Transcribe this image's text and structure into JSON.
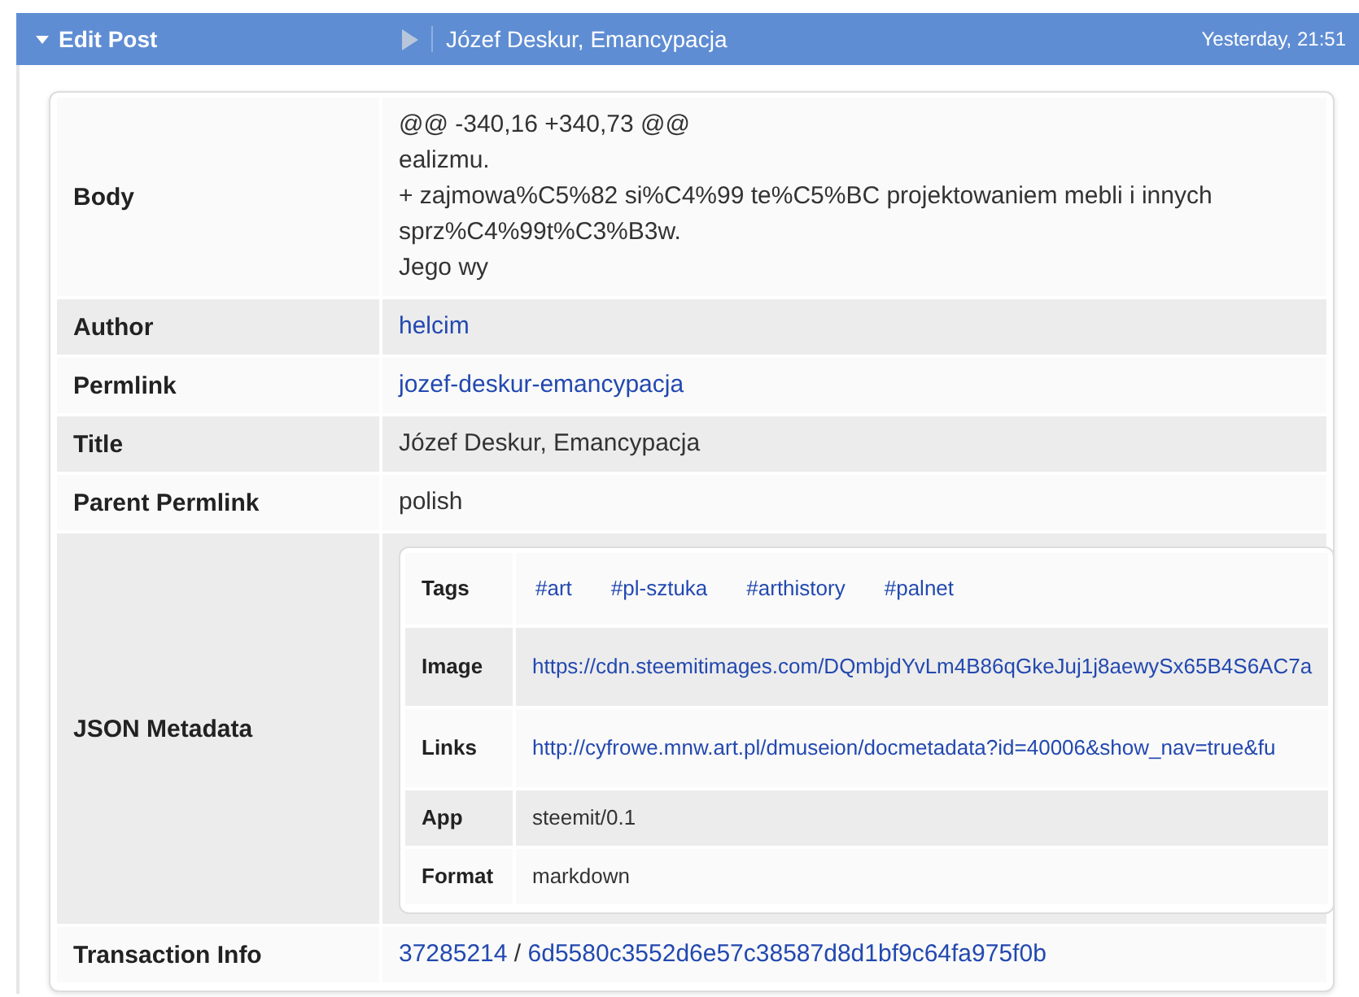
{
  "header": {
    "title": "Edit Post",
    "post_title": "Józef Deskur, Emancypacja",
    "time": "Yesterday, 21:51",
    "expanded": true
  },
  "fields": [
    {
      "label": "Body",
      "kind": "lines",
      "lines": [
        "@@ -340,16 +340,73 @@",
        "ealizmu.",
        "+ zajmowa%C5%82 si%C4%99 te%C5%BC projektowaniem mebli i innych sprz%C4%99t%C3%B3w.",
        "Jego wy"
      ]
    },
    {
      "label": "Author",
      "kind": "link",
      "value": "helcim"
    },
    {
      "label": "Permlink",
      "kind": "link",
      "value": "jozef-deskur-emancypacja"
    },
    {
      "label": "Title",
      "kind": "text",
      "value": "Józef Deskur, Emancypacja"
    },
    {
      "label": "Parent Permlink",
      "kind": "text",
      "value": "polish"
    },
    {
      "label": "JSON Metadata",
      "kind": "table",
      "rows": [
        {
          "label": "Tags",
          "kind": "tags",
          "tags": [
            "#art",
            "#pl-sztuka",
            "#arthistory",
            "#palnet"
          ]
        },
        {
          "label": "Image",
          "kind": "link",
          "value": "https://cdn.steemitimages.com/DQmbjdYvLm4B86qGkeJuj1j8aewySx65B4S6AC7a"
        },
        {
          "label": "Links",
          "kind": "link",
          "value": "http://cyfrowe.mnw.art.pl/dmuseion/docmetadata?id=40006&show_nav=true&fu"
        },
        {
          "label": "App",
          "kind": "text",
          "value": "steemit/0.1"
        },
        {
          "label": "Format",
          "kind": "text",
          "value": "markdown"
        }
      ]
    },
    {
      "label": "Transaction Info",
      "kind": "tx",
      "block": "37285214",
      "separator": "/",
      "trx": "6d5580c3552d6e57c38587d8d1bf9c64fa975f0b"
    }
  ]
}
